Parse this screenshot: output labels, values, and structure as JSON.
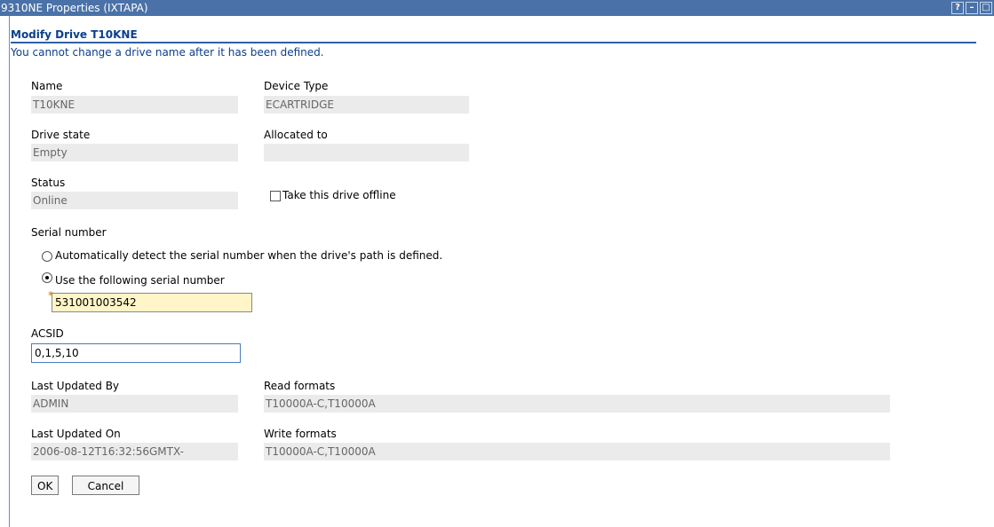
{
  "window": {
    "title": "9310NE Properties (IXTAPA)",
    "controls": [
      "?",
      "–",
      "□"
    ]
  },
  "page": {
    "heading": "Modify Drive T10KNE",
    "info": "You cannot change a drive name after it has been defined."
  },
  "fields": {
    "name": {
      "label": "Name",
      "value": "T10KNE"
    },
    "device_type": {
      "label": "Device Type",
      "value": "ECARTRIDGE"
    },
    "drive_state": {
      "label": "Drive state",
      "value": "Empty"
    },
    "allocated_to": {
      "label": "Allocated to",
      "value": ""
    },
    "status": {
      "label": "Status",
      "value": "Online"
    },
    "offline": {
      "label": "Take this drive offline",
      "checked": false
    },
    "serial": {
      "label": "Serial number",
      "option_auto": "Automatically detect the serial number when the drive's path is defined.",
      "option_manual": "Use the following serial number",
      "selected": "manual",
      "required_mark": "*",
      "value": "531001003542"
    },
    "acsid": {
      "label": "ACSID",
      "value": "0,1,5,10"
    },
    "last_updated_by": {
      "label": "Last Updated By",
      "value": "ADMIN"
    },
    "read_formats": {
      "label": "Read formats",
      "value": "T10000A-C,T10000A"
    },
    "last_updated_on": {
      "label": "Last Updated On",
      "value": "2006-08-12T16:32:56GMTX-"
    },
    "write_formats": {
      "label": "Write formats",
      "value": "T10000A-C,T10000A"
    }
  },
  "buttons": {
    "ok": "OK",
    "cancel": "Cancel"
  }
}
